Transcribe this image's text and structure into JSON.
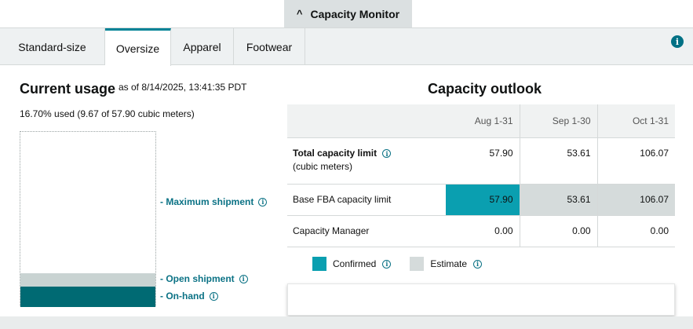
{
  "monitor": {
    "title": "Capacity Monitor",
    "chevron": "^"
  },
  "tabs": [
    {
      "label": "Standard-size"
    },
    {
      "label": "Oversize"
    },
    {
      "label": "Apparel"
    },
    {
      "label": "Footwear"
    }
  ],
  "info_icon": "i",
  "current_usage": {
    "title": "Current usage",
    "as_of": "as of 8/14/2025, 13:41:35 PDT",
    "used_text": "16.70% used (9.67 of 57.90 cubic meters)",
    "used_fraction": 0.167,
    "labels": {
      "maximum": "- Maximum shipment",
      "open": "- Open shipment",
      "onhand": "- On-hand"
    }
  },
  "outlook": {
    "title": "Capacity outlook",
    "columns": [
      "Aug 1-31",
      "Sep 1-30",
      "Oct 1-31"
    ],
    "rows": [
      {
        "label": "Total capacity limit",
        "sublabel": "(cubic meters)",
        "values": [
          "57.90",
          "53.61",
          "106.07"
        ]
      },
      {
        "label": "Base FBA capacity limit",
        "values": [
          "57.90",
          "53.61",
          "106.07"
        ]
      },
      {
        "label": "Capacity Manager",
        "values": [
          "0.00",
          "0.00",
          "0.00"
        ]
      }
    ],
    "legend": {
      "confirmed": "Confirmed",
      "estimate": "Estimate"
    }
  },
  "colors": {
    "accent": "#008296",
    "confirmed": "#0a9fb0",
    "estimate": "#d5dbdb",
    "onhand": "#006a73",
    "open_shipment": "#c9d3d2"
  }
}
